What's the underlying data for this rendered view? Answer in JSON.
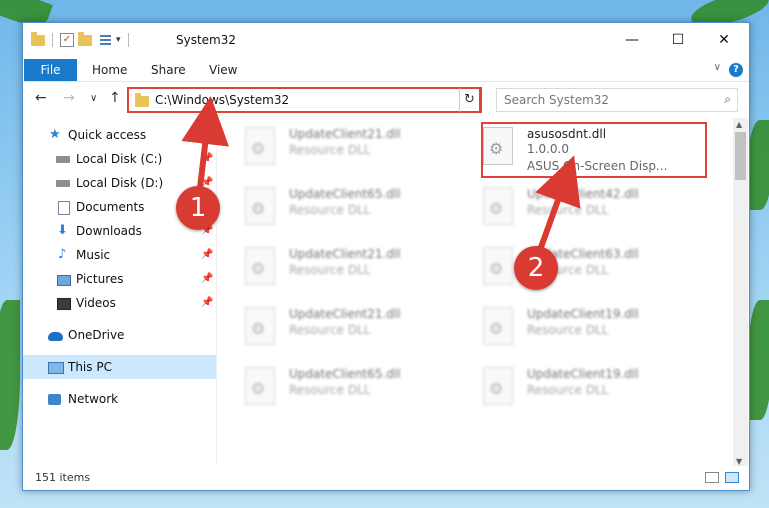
{
  "window": {
    "title": "System32",
    "controls": {
      "minimize": "—",
      "maximize": "☐",
      "close": "✕"
    }
  },
  "ribbon": {
    "tabs": [
      "File",
      "Home",
      "Share",
      "View"
    ],
    "help": "?",
    "expand": "∨"
  },
  "nav": {
    "back": "←",
    "forward": "→",
    "recent": "∨",
    "up": "↑",
    "address": "C:\\Windows\\System32",
    "address_dropdown": "∨",
    "refresh": "↻",
    "search_placeholder": "Search System32",
    "search_icon": "⌕"
  },
  "sidebar": {
    "items": [
      {
        "label": "Quick access",
        "icon": "star-icon",
        "pinned": false
      },
      {
        "label": "Local Disk (C:)",
        "icon": "disk-icon",
        "pinned": true
      },
      {
        "label": "Local Disk (D:)",
        "icon": "disk-icon",
        "pinned": true
      },
      {
        "label": "Documents",
        "icon": "document-icon",
        "pinned": true
      },
      {
        "label": "Downloads",
        "icon": "download-icon",
        "pinned": true
      },
      {
        "label": "Music",
        "icon": "music-icon",
        "pinned": true
      },
      {
        "label": "Pictures",
        "icon": "pictures-icon",
        "pinned": true
      },
      {
        "label": "Videos",
        "icon": "videos-icon",
        "pinned": true
      },
      {
        "label": "OneDrive",
        "icon": "onedrive-icon",
        "pinned": false
      },
      {
        "label": "This PC",
        "icon": "this-pc-icon",
        "pinned": false,
        "selected": true
      },
      {
        "label": "Network",
        "icon": "network-icon",
        "pinned": false
      }
    ]
  },
  "files": {
    "highlighted": {
      "name": "asusosdnt.dll",
      "version": "1.0.0.0",
      "description": "ASUS On-Screen Disp..."
    },
    "left_column": [
      {
        "name": "UpdateClient21.dll",
        "type": "Resource DLL"
      },
      {
        "name": "UpdateClient65.dll",
        "type": "Resource DLL"
      },
      {
        "name": "UpdateClient21.dll",
        "type": "Resource DLL"
      },
      {
        "name": "UpdateClient21.dll",
        "type": "Resource DLL"
      },
      {
        "name": "UpdateClient65.dll",
        "type": "Resource DLL"
      }
    ],
    "right_column": [
      {
        "name": "UpdateClient42.dll",
        "type": "Resource DLL"
      },
      {
        "name": "UpdateClient63.dll",
        "type": "Resource DLL"
      },
      {
        "name": "UpdateClient19.dll",
        "type": "Resource DLL"
      },
      {
        "name": "UpdateClient19.dll",
        "type": "Resource DLL"
      }
    ]
  },
  "status": {
    "item_count": "151 items"
  },
  "markers": {
    "one": "1",
    "two": "2"
  },
  "colors": {
    "accent": "#1979ca",
    "highlight_red": "#e0413a",
    "marker_red": "#d93a32"
  }
}
